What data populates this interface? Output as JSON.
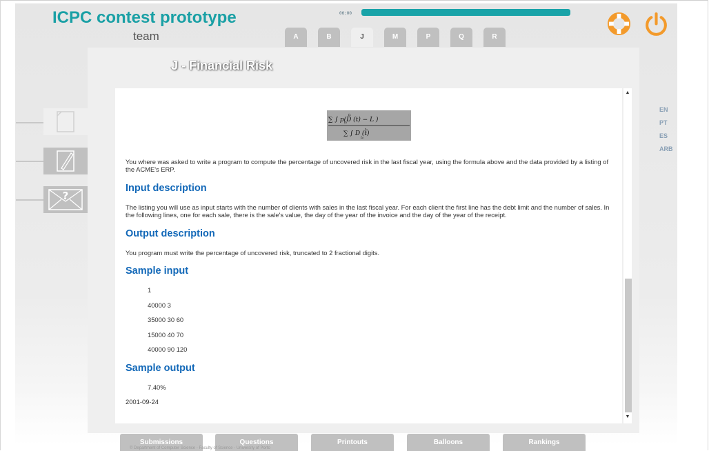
{
  "header": {
    "app_title": "ICPC contest prototype",
    "team": "team",
    "timer": "06:00",
    "progress_percent": 100
  },
  "problem_tabs": [
    {
      "label": "A",
      "active": false
    },
    {
      "label": "B",
      "active": false
    },
    {
      "label": "J",
      "active": true
    },
    {
      "label": "M",
      "active": false
    },
    {
      "label": "P",
      "active": false
    },
    {
      "label": "Q",
      "active": false
    },
    {
      "label": "R",
      "active": false
    }
  ],
  "problem": {
    "title": "J - Financial Risk",
    "intro": "You where was asked to write a program to compute the percentage of uncovered risk in the last fiscal year, using the formula above and the data provided by a listing of the ACME's ERP.",
    "input_heading": "Input description",
    "input_text": "The listing you will use as input starts with the number of clients with sales in the last fiscal year. For each client the first line has the debt limit and the number of sales. In the following lines, one for each sale, there is the sale's value, the day of the year of the invoice and the day of the year of the receipt.",
    "output_heading": "Output description",
    "output_text": "You program must write the percentage of uncovered risk, truncated to 2 fractional digits.",
    "sample_input_heading": "Sample input",
    "sample_input": [
      "1",
      "40000 3",
      "35000 30 60",
      "15000 40 70",
      "40000 90 120"
    ],
    "sample_output_heading": "Sample output",
    "sample_output": [
      "7.40%"
    ],
    "date": "2001-09-24"
  },
  "languages": [
    "EN",
    "PT",
    "ES",
    "ARB"
  ],
  "bottom_nav": [
    "Submissions",
    "Questions",
    "Printouts",
    "Balloons",
    "Rankings"
  ],
  "footer": "© Department of Computer Science - Faculty of Science - University of Porto",
  "colors": {
    "accent": "#1aa0a5",
    "heading": "#1268b8",
    "tab_inactive": "#c0c0c0",
    "icon_orange": "#f39a2b"
  },
  "icons": [
    "problem-sheet-icon",
    "edit-sheet-icon",
    "question-mail-icon",
    "lifebuoy-icon",
    "power-icon"
  ]
}
